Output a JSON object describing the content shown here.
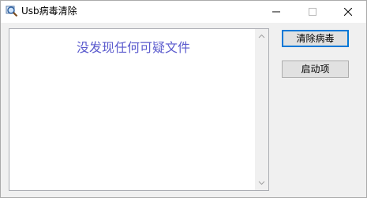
{
  "window": {
    "title": "Usb病毒清除",
    "icon": "magnifier-app-icon",
    "controls": {
      "minimize": "minimize-icon",
      "maximize": "maximize-icon",
      "close": "close-icon"
    }
  },
  "results_list": {
    "message": "没发现任何可疑文件"
  },
  "buttons": {
    "clean_label": "清除病毒",
    "startup_label": "启动项"
  },
  "colors": {
    "message_text": "#5a5acd",
    "default_button_border": "#0078d7"
  }
}
